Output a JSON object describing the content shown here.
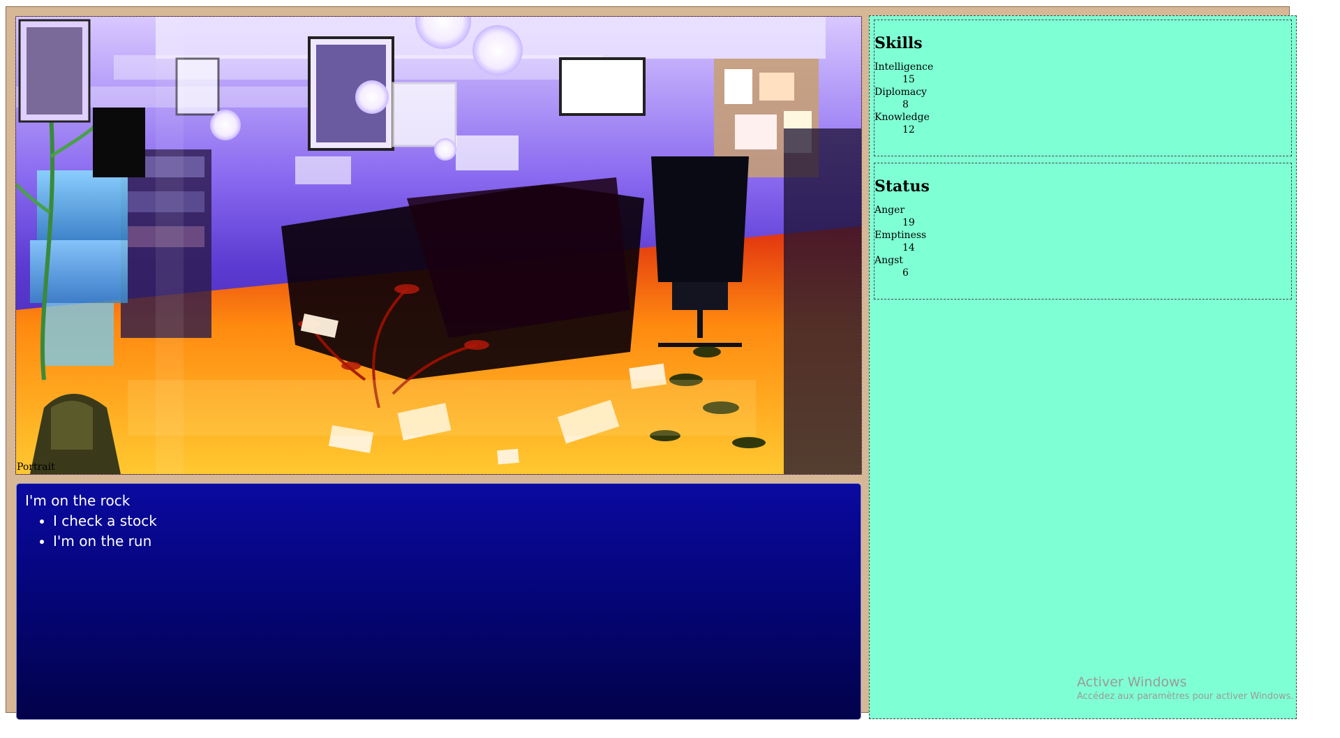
{
  "scene": {
    "portrait_label": "Portrait"
  },
  "dialogue": {
    "line": "I'm on the rock",
    "choices": [
      "I check a stock",
      "I'm on the run"
    ]
  },
  "skills": {
    "title": "Skills",
    "items": [
      {
        "name": "Intelligence",
        "value": "15"
      },
      {
        "name": "Diplomacy",
        "value": "8"
      },
      {
        "name": "Knowledge",
        "value": "12"
      }
    ]
  },
  "status": {
    "title": "Status",
    "items": [
      {
        "name": "Anger",
        "value": "19"
      },
      {
        "name": "Emptiness",
        "value": "14"
      },
      {
        "name": "Angst",
        "value": "6"
      }
    ]
  },
  "watermark": {
    "title": "Activer Windows",
    "subtitle": "Accédez aux paramètres pour activer Windows."
  },
  "colors": {
    "frame": "#d7b896",
    "panel": "#7fffd4",
    "dialogue_top": "#0a0aa0",
    "dialogue_bottom": "#02024a"
  }
}
